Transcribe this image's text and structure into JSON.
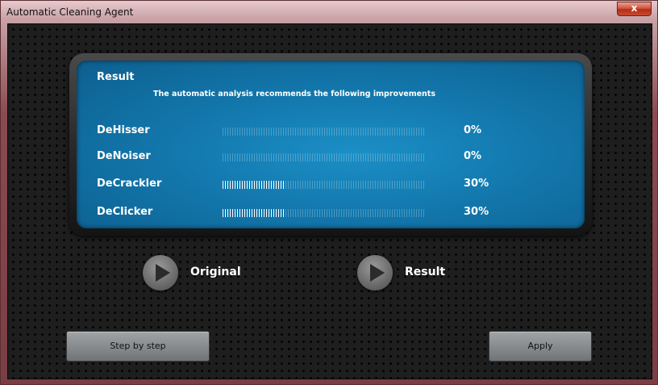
{
  "window": {
    "title": "Automatic Cleaning Agent",
    "close_label": "x"
  },
  "result_panel": {
    "title": "Result",
    "subtitle": "The automatic analysis recommends the following improvements",
    "rows": [
      {
        "label": "DeHisser",
        "value": "0%",
        "level": 0
      },
      {
        "label": "DeNoiser",
        "value": "0%",
        "level": 0
      },
      {
        "label": "DeCrackler",
        "value": "30%",
        "level": 30
      },
      {
        "label": "DeClicker",
        "value": "30%",
        "level": 30
      }
    ]
  },
  "playback": {
    "original_label": "Original",
    "result_label": "Result"
  },
  "buttons": {
    "step_label": "Step by step",
    "apply_label": "Apply"
  },
  "colors": {
    "panel_accent": "#1378ad",
    "background": "#1e1e1e"
  },
  "icons": {
    "play_original": "play-icon",
    "play_result": "play-icon",
    "close": "close-icon"
  }
}
